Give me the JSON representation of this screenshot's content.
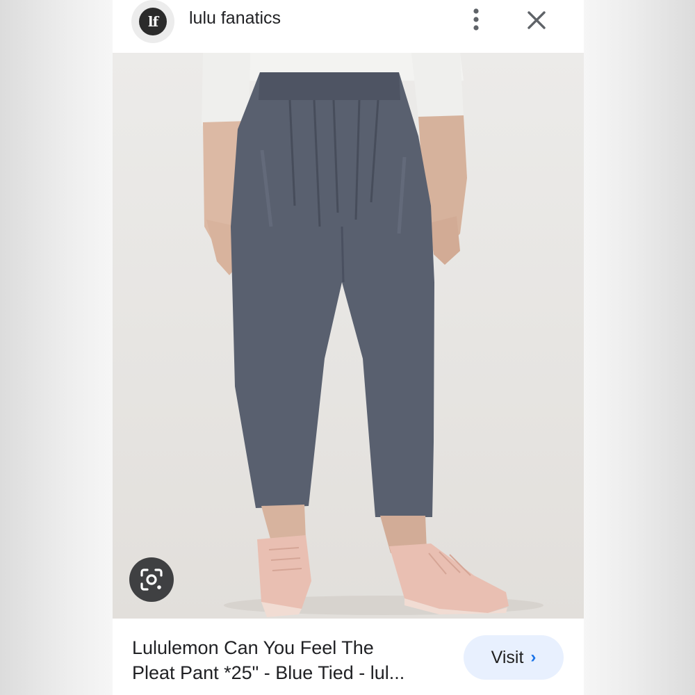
{
  "header": {
    "logo_text": "lf",
    "source_name": "lulu fanatics"
  },
  "icons": {
    "more": "more-vert-icon",
    "close": "close-icon",
    "lens": "google-lens-icon",
    "chevron": "chevron-right-icon"
  },
  "result": {
    "title_line1": "Lululemon Can You Feel The",
    "title_line2": "Pleat Pant *25\" - Blue Tied - lul...",
    "visit_label": "Visit",
    "visit_chevron": "›"
  },
  "colors": {
    "pant": "#59606f",
    "shoe": "#e9bfb2",
    "visit_bg": "#e8f0fe",
    "accent": "#1a73e8"
  }
}
